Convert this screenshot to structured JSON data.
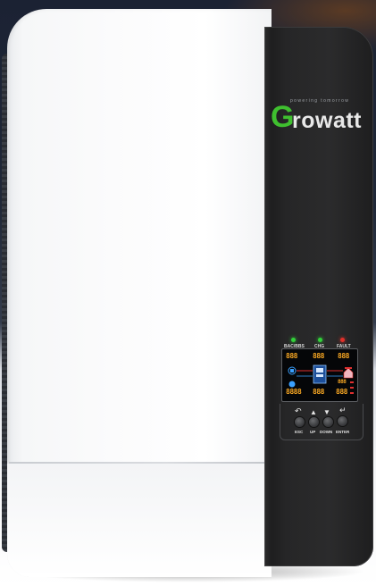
{
  "brand": {
    "tagline": "powering tomorrow",
    "logo_initial": "G",
    "logo_rest": "rowatt",
    "logo_green": "#3fbf2f"
  },
  "status_leds": [
    {
      "label": "BAC/BBS",
      "color": "#32d13a"
    },
    {
      "label": "CHG",
      "color": "#32d13a"
    },
    {
      "label": "FAULT",
      "color": "#e0302a"
    }
  ],
  "lcd": {
    "top_left": "888",
    "top_mid": "888",
    "top_right": "888",
    "mid_right": "888",
    "bottom_left": "8888",
    "bottom_mid": "888",
    "bottom_right": "888",
    "segment_color": "#f6a623"
  },
  "keypad": {
    "keys": [
      {
        "symbol": "↶",
        "label": "ESC"
      },
      {
        "symbol": "▲",
        "label": "UP"
      },
      {
        "symbol": "▼",
        "label": "DOWN"
      },
      {
        "symbol": "↵",
        "label": "ENTER"
      }
    ]
  }
}
